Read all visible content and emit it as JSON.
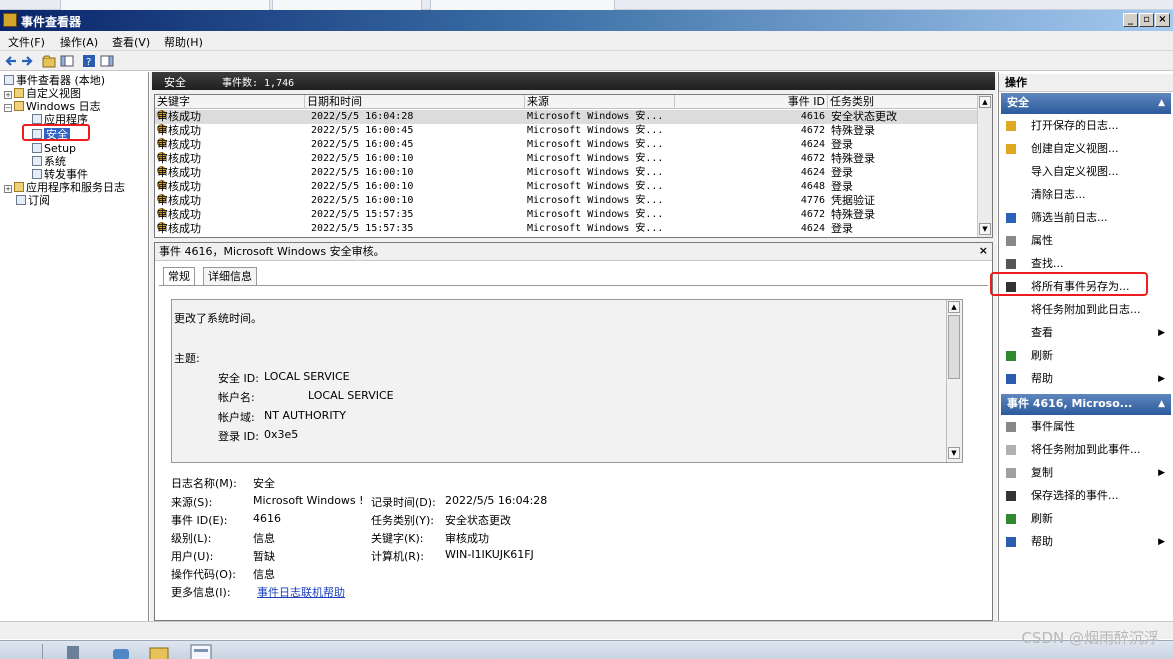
{
  "window": {
    "title": "事件查看器"
  },
  "menu": [
    "文件(F)",
    "操作(A)",
    "查看(V)",
    "帮助(H)"
  ],
  "tree": {
    "items": [
      {
        "label": "事件查看器 (本地)"
      },
      {
        "label": "自定义视图"
      },
      {
        "label": "Windows 日志"
      },
      {
        "label": "应用程序"
      },
      {
        "label": "安全"
      },
      {
        "label": "Setup"
      },
      {
        "label": "系统"
      },
      {
        "label": "转发事件"
      },
      {
        "label": "应用程序和服务日志"
      },
      {
        "label": "订阅"
      }
    ]
  },
  "log_header": {
    "name": "安全",
    "count_label": "事件数: 1,746"
  },
  "list": {
    "columns": [
      "关键字",
      "日期和时间",
      "来源",
      "事件 ID",
      "任务类别"
    ],
    "rows": [
      {
        "kw": "审核成功",
        "dt": "2022/5/5 16:04:28",
        "src": "Microsoft Windows 安...",
        "id": "4616",
        "cat": "安全状态更改"
      },
      {
        "kw": "审核成功",
        "dt": "2022/5/5 16:00:45",
        "src": "Microsoft Windows 安...",
        "id": "4672",
        "cat": "特殊登录"
      },
      {
        "kw": "审核成功",
        "dt": "2022/5/5 16:00:45",
        "src": "Microsoft Windows 安...",
        "id": "4624",
        "cat": "登录"
      },
      {
        "kw": "审核成功",
        "dt": "2022/5/5 16:00:10",
        "src": "Microsoft Windows 安...",
        "id": "4672",
        "cat": "特殊登录"
      },
      {
        "kw": "审核成功",
        "dt": "2022/5/5 16:00:10",
        "src": "Microsoft Windows 安...",
        "id": "4624",
        "cat": "登录"
      },
      {
        "kw": "审核成功",
        "dt": "2022/5/5 16:00:10",
        "src": "Microsoft Windows 安...",
        "id": "4648",
        "cat": "登录"
      },
      {
        "kw": "审核成功",
        "dt": "2022/5/5 16:00:10",
        "src": "Microsoft Windows 安...",
        "id": "4776",
        "cat": "凭据验证"
      },
      {
        "kw": "审核成功",
        "dt": "2022/5/5 15:57:35",
        "src": "Microsoft Windows 安...",
        "id": "4672",
        "cat": "特殊登录"
      },
      {
        "kw": "审核成功",
        "dt": "2022/5/5 15:57:35",
        "src": "Microsoft Windows 安...",
        "id": "4624",
        "cat": "登录"
      }
    ]
  },
  "detail": {
    "title": "事件 4616，Microsoft Windows 安全审核。",
    "close": "×",
    "tabs": [
      "常规",
      "详细信息"
    ],
    "message": {
      "line1": "更改了系统时间。",
      "subject_label": "主题:",
      "fields": [
        {
          "k": "安全 ID:",
          "v": "LOCAL SERVICE"
        },
        {
          "k": "帐户名:",
          "v": "LOCAL SERVICE"
        },
        {
          "k": "帐户域:",
          "v": "NT AUTHORITY"
        },
        {
          "k": "登录 ID:",
          "v": "0x3e5"
        }
      ]
    },
    "props": {
      "log_name_k": "日志名称(M):",
      "log_name_v": "安全",
      "source_k": "来源(S):",
      "source_v": "Microsoft Windows !",
      "recorded_k": "记录时间(D):",
      "recorded_v": "2022/5/5 16:04:28",
      "event_id_k": "事件 ID(E):",
      "event_id_v": "4616",
      "task_k": "任务类别(Y):",
      "task_v": "安全状态更改",
      "level_k": "级别(L):",
      "level_v": "信息",
      "keywords_k": "关键字(K):",
      "keywords_v": "审核成功",
      "user_k": "用户(U):",
      "user_v": "暂缺",
      "computer_k": "计算机(R):",
      "computer_v": "WIN-I1IKUJK61FJ",
      "opcode_k": "操作代码(O):",
      "opcode_v": "信息",
      "more_k": "更多信息(I):",
      "more_v": "事件日志联机帮助"
    }
  },
  "actions": {
    "title": "操作",
    "group1": "安全",
    "items1": [
      {
        "label": "打开保存的日志..."
      },
      {
        "label": "创建自定义视图..."
      },
      {
        "label": "导入自定义视图..."
      },
      {
        "label": "清除日志..."
      },
      {
        "label": "筛选当前日志..."
      },
      {
        "label": "属性"
      },
      {
        "label": "查找..."
      },
      {
        "label": "将所有事件另存为..."
      },
      {
        "label": "将任务附加到此日志..."
      },
      {
        "label": "查看"
      },
      {
        "label": "刷新"
      },
      {
        "label": "帮助"
      }
    ],
    "group2": "事件 4616, Microso...",
    "items2": [
      {
        "label": "事件属性"
      },
      {
        "label": "将任务附加到此事件..."
      },
      {
        "label": "复制"
      },
      {
        "label": "保存选择的事件..."
      },
      {
        "label": "刷新"
      },
      {
        "label": "帮助"
      }
    ]
  },
  "watermark": "CSDN @烟雨醉沉浮",
  "colors": {
    "highlight_red": "#ee1c1c",
    "titlebar": "#0a246a",
    "action_group": "#2c5a9d"
  }
}
